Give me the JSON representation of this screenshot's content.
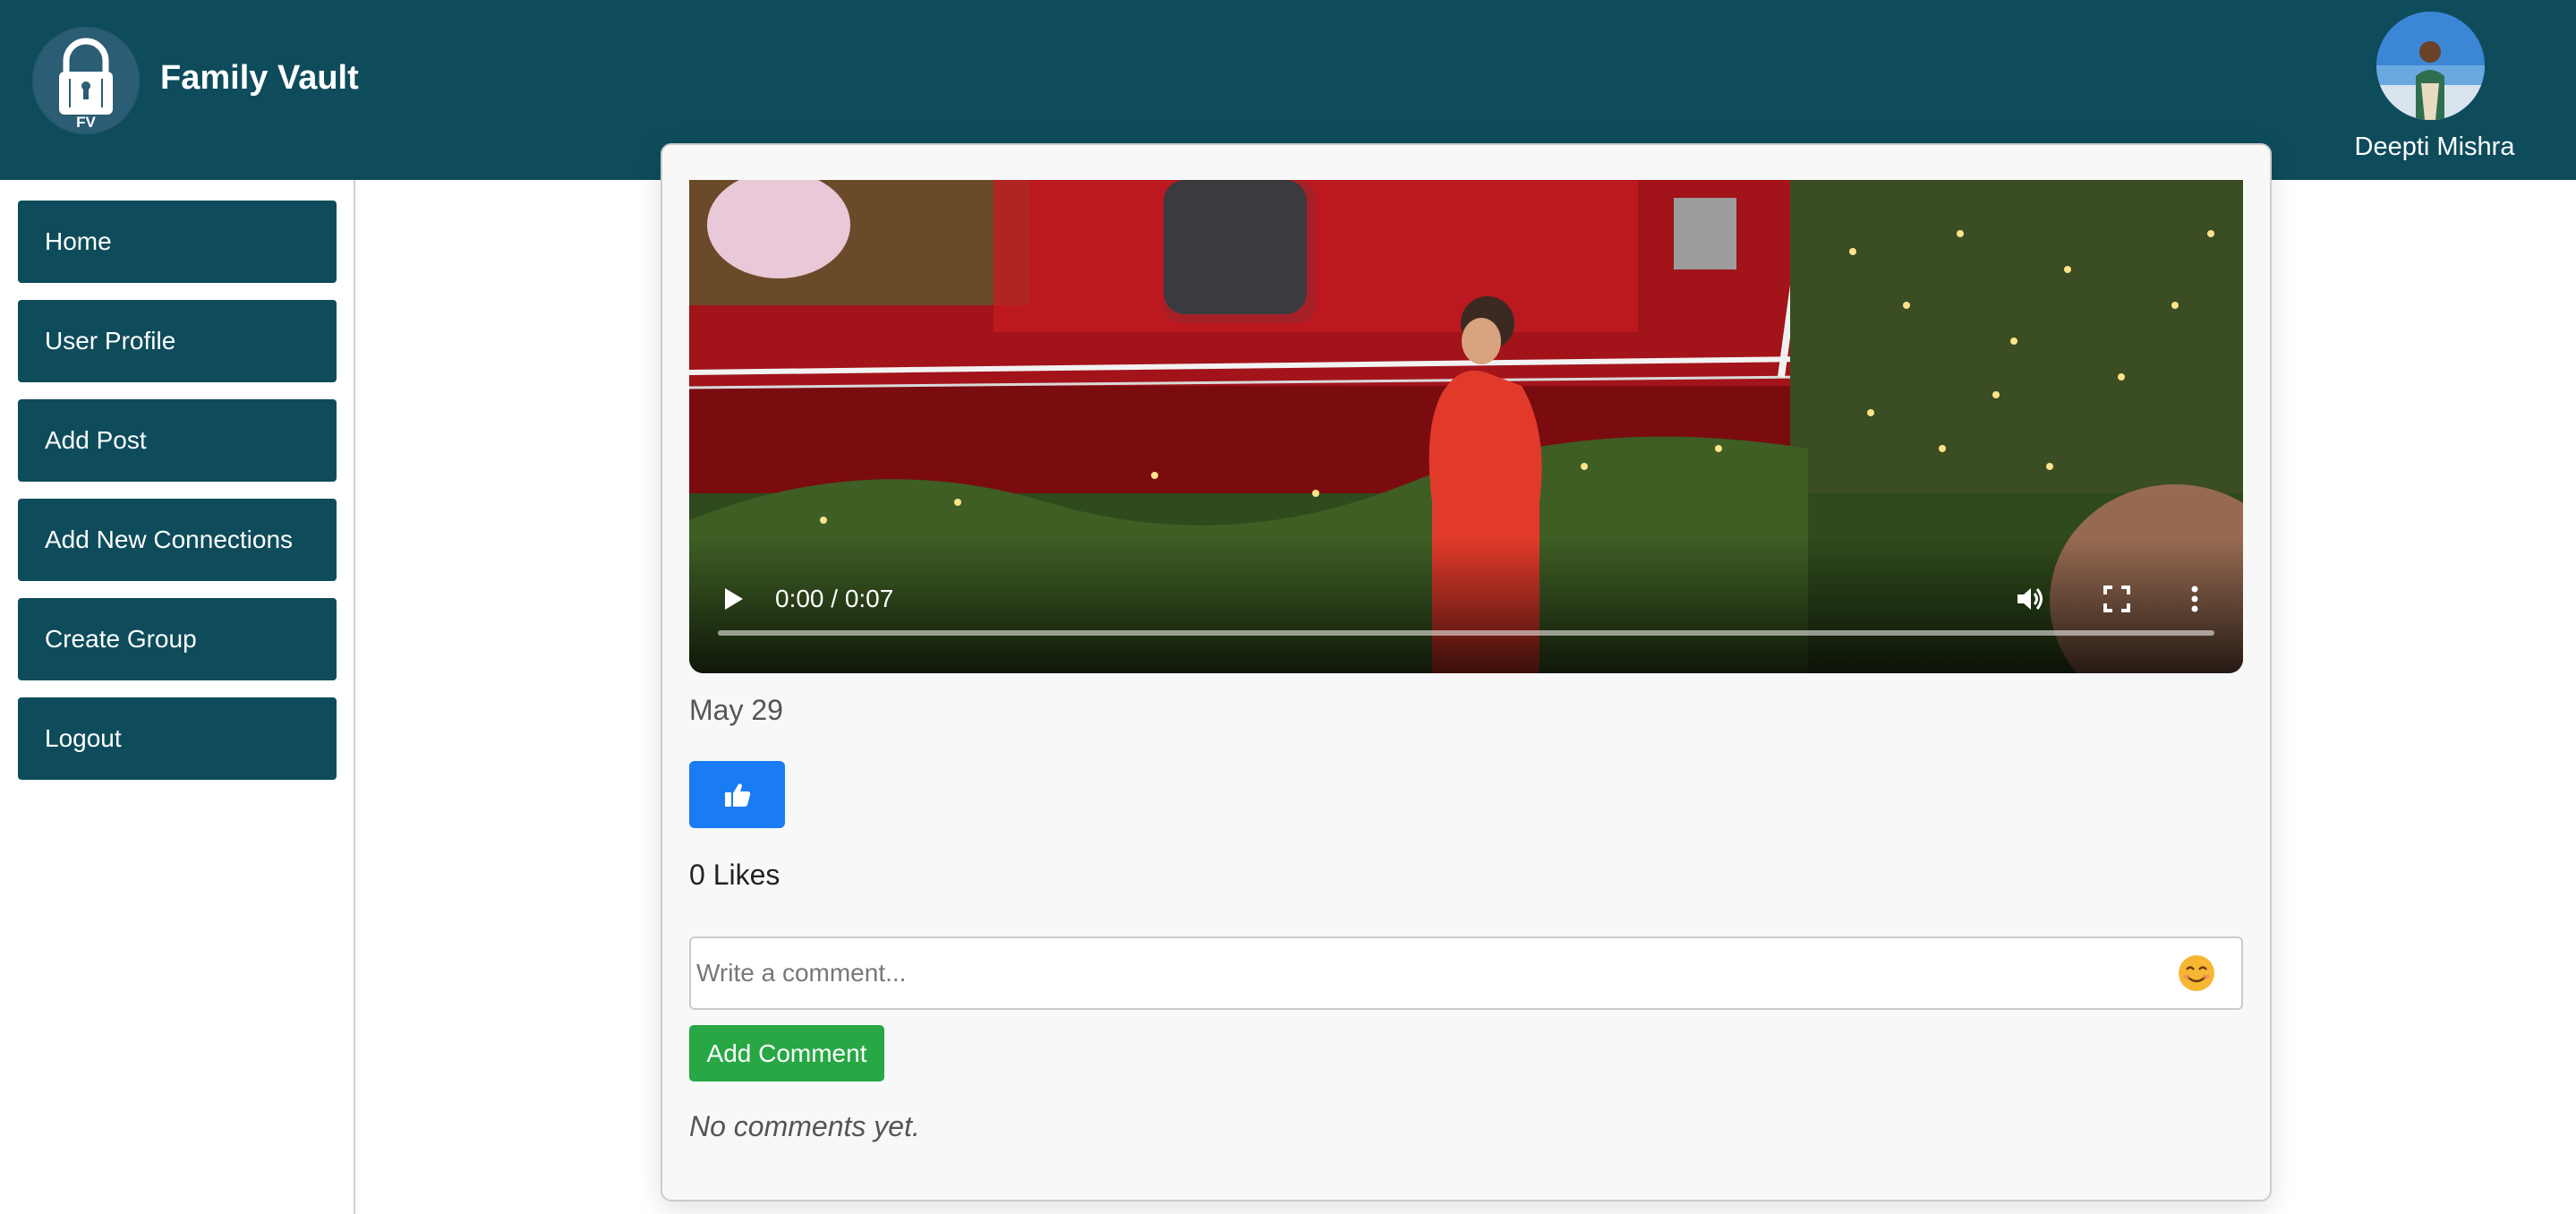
{
  "header": {
    "app_title": "Family Vault",
    "logo_text": "FV",
    "user_name": "Deepti Mishra"
  },
  "sidebar": {
    "items": [
      {
        "label": "Home"
      },
      {
        "label": "User Profile"
      },
      {
        "label": "Add Post"
      },
      {
        "label": "Add New Connections"
      },
      {
        "label": "Create Group"
      },
      {
        "label": "Logout"
      }
    ]
  },
  "post": {
    "video": {
      "time_display": "0:00 / 0:07",
      "progress": 0
    },
    "date": "May 29",
    "likes_text": "0 Likes",
    "comment_placeholder": "Write a comment...",
    "emoji": "😊",
    "add_comment_label": "Add Comment",
    "no_comments_text": "No comments yet."
  },
  "colors": {
    "header_bg": "#0e4c5c",
    "nav_button_bg": "#0e4c5c",
    "like_button_bg": "#1a7cf5",
    "add_comment_bg": "#28a745"
  },
  "icons": {
    "logo": "lock-icon",
    "like": "thumbs-up-icon",
    "play": "play-icon",
    "volume": "volume-icon",
    "fullscreen": "fullscreen-icon",
    "more": "more-vertical-icon",
    "emoji": "smiley-emoji-icon"
  }
}
